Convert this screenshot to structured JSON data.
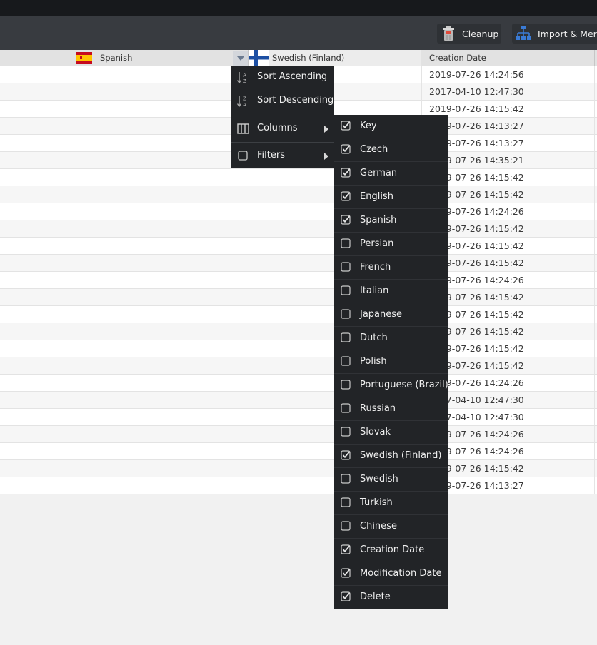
{
  "toolbar": {
    "cleanup_label": "Cleanup",
    "import_merge_label": "Import & Merge"
  },
  "grid": {
    "columns": [
      {
        "label": "Spanish",
        "flag": "spain-flag"
      },
      {
        "label": "Swedish (Finland)",
        "flag": "finland-flag"
      },
      {
        "label": "Creation Date"
      }
    ],
    "creation_dates": [
      "2019-07-26 14:24:56",
      "2017-04-10 12:47:30",
      "2019-07-26 14:15:42",
      "2019-07-26 14:13:27",
      "2019-07-26 14:13:27",
      "2019-07-26 14:35:21",
      "2019-07-26 14:15:42",
      "2019-07-26 14:15:42",
      "2019-07-26 14:24:26",
      "2019-07-26 14:15:42",
      "2019-07-26 14:15:42",
      "2019-07-26 14:15:42",
      "2019-07-26 14:24:26",
      "2019-07-26 14:15:42",
      "2019-07-26 14:15:42",
      "2019-07-26 14:15:42",
      "2019-07-26 14:15:42",
      "2019-07-26 14:15:42",
      "2019-07-26 14:24:26",
      "2017-04-10 12:47:30",
      "2017-04-10 12:47:30",
      "2019-07-26 14:24:26",
      "2019-07-26 14:24:26",
      "2019-07-26 14:15:42",
      "2019-07-26 14:13:27"
    ]
  },
  "column_menu": {
    "sort_ascending": "Sort Ascending",
    "sort_descending": "Sort Descending",
    "columns": "Columns",
    "filters": "Filters"
  },
  "columns_submenu": [
    {
      "label": "Key",
      "checked": true
    },
    {
      "label": "Czech",
      "checked": true
    },
    {
      "label": "German",
      "checked": true
    },
    {
      "label": "English",
      "checked": true
    },
    {
      "label": "Spanish",
      "checked": true
    },
    {
      "label": "Persian",
      "checked": false
    },
    {
      "label": "French",
      "checked": false
    },
    {
      "label": "Italian",
      "checked": false
    },
    {
      "label": "Japanese",
      "checked": false
    },
    {
      "label": "Dutch",
      "checked": false
    },
    {
      "label": "Polish",
      "checked": false
    },
    {
      "label": "Portuguese (Brazil)",
      "checked": false
    },
    {
      "label": "Russian",
      "checked": false
    },
    {
      "label": "Slovak",
      "checked": false
    },
    {
      "label": "Swedish (Finland)",
      "checked": true
    },
    {
      "label": "Swedish",
      "checked": false
    },
    {
      "label": "Turkish",
      "checked": false
    },
    {
      "label": "Chinese",
      "checked": false
    },
    {
      "label": "Creation Date",
      "checked": true
    },
    {
      "label": "Modification Date",
      "checked": true
    },
    {
      "label": "Delete",
      "checked": true
    }
  ],
  "colors": {
    "menu_bg": "#222427",
    "toolbar_bg": "#383b40",
    "accent_blue": "#3a7bd5"
  }
}
